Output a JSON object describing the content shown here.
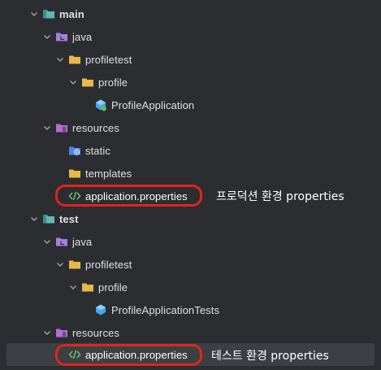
{
  "tree": {
    "main": {
      "label": "main"
    },
    "main_java": {
      "label": "java"
    },
    "main_profiletest": {
      "label": "profiletest"
    },
    "main_profile": {
      "label": "profile"
    },
    "main_app_class": {
      "label": "ProfileApplication"
    },
    "main_resources": {
      "label": "resources"
    },
    "main_static": {
      "label": "static"
    },
    "main_templates": {
      "label": "templates"
    },
    "main_properties": {
      "label": "application.properties"
    },
    "test": {
      "label": "test"
    },
    "test_java": {
      "label": "java"
    },
    "test_profiletest": {
      "label": "profiletest"
    },
    "test_profile": {
      "label": "profile"
    },
    "test_app_class": {
      "label": "ProfileApplicationTests"
    },
    "test_resources": {
      "label": "resources"
    },
    "test_properties": {
      "label": "application.properties"
    }
  },
  "annotations": {
    "production": "프로덕션 환경 properties",
    "test": "테스트 환경 properties"
  },
  "colors": {
    "background": "#2b2d30",
    "text": "#dfe1e5",
    "selection": "#3c3f44",
    "highlight": "#e3241b",
    "folder": "#e8b84a",
    "module_folder": "#5fb8b1",
    "source_folder": "#a87ee0",
    "resource_folder": "#b36bd6",
    "static_folder": "#4a86e8",
    "class_icon": "#3fa9f5"
  },
  "icons": {
    "expanded": "chevron-down-icon",
    "module": "module-folder-icon",
    "source_root": "source-root-folder-icon",
    "resources_root": "resources-root-folder-icon",
    "folder": "folder-icon",
    "web_folder": "web-folder-icon",
    "spring_boot_app": "spring-boot-class-icon",
    "test_class": "test-class-icon",
    "properties": "properties-file-icon"
  }
}
